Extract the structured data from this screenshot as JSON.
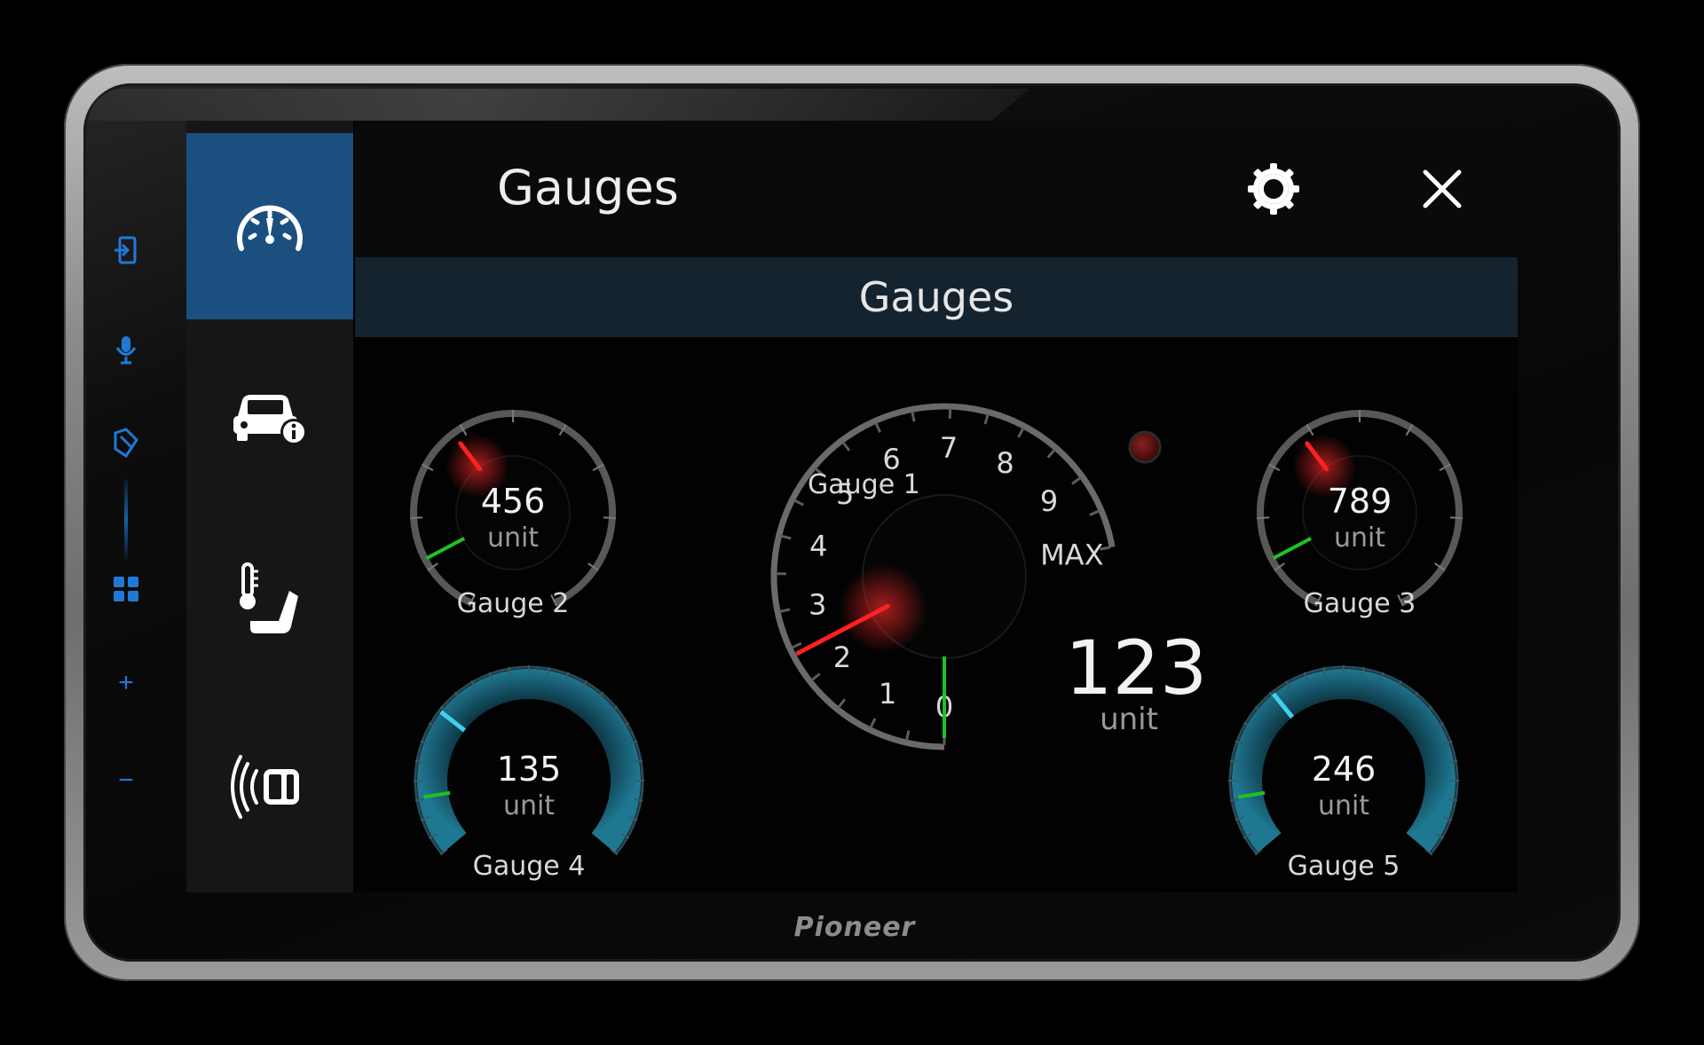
{
  "brand": "Pioneer",
  "header": {
    "title": "Gauges"
  },
  "subheader": {
    "title": "Gauges"
  },
  "nav": {
    "items": [
      {
        "icon": "speedometer-icon",
        "active": true
      },
      {
        "icon": "car-info-icon",
        "active": false
      },
      {
        "icon": "seat-temperature-icon",
        "active": false
      },
      {
        "icon": "parking-sensor-icon",
        "active": false
      }
    ]
  },
  "hardware_buttons": {
    "plus": "+",
    "minus": "−"
  },
  "gauges": {
    "gauge1": {
      "label": "Gauge 1",
      "value": "123",
      "unit": "unit",
      "ticks": [
        "0",
        "1",
        "2",
        "3",
        "4",
        "5",
        "6",
        "7",
        "8",
        "9",
        "MAX"
      ],
      "needle_position": 0.24,
      "needle_color": "#ff2020",
      "zero_color": "#22c022"
    },
    "gauge2": {
      "label": "Gauge 2",
      "value": "456",
      "unit": "unit",
      "needle_position": 0.38
    },
    "gauge3": {
      "label": "Gauge 3",
      "value": "789",
      "unit": "unit",
      "needle_position": 0.38
    },
    "gauge4": {
      "label": "Gauge 4",
      "value": "135",
      "unit": "unit",
      "needle_position": 0.3
    },
    "gauge5": {
      "label": "Gauge 5",
      "value": "246",
      "unit": "unit",
      "needle_position": 0.35
    }
  },
  "colors": {
    "accent": "#1b4f80",
    "subheader_bg": "#15232e",
    "needle_red": "#ff2020",
    "marker_green": "#22c022",
    "marker_cyan": "#3fd0f0",
    "fill_teal": "#1d6f8a",
    "warning_light": "#5a1010"
  }
}
